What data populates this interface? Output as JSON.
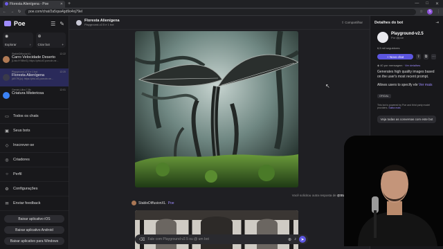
{
  "browser": {
    "tab_title": "Floresta Alienígena - Poe",
    "url": "poe.com/chat/2a5qsa4gd9o4nj79el",
    "profile_initial": "S"
  },
  "sidebar": {
    "logo": "Poe",
    "explore_label": "Explorar",
    "create_bot_label": "Criar bot",
    "conversations": [
      {
        "bot": "StableDiffusionXL",
        "time": "12:22",
        "title": "Carro Velocidade Deserto",
        "snippet": "[Link=fY98hrG]: https://pfst.cf2.poecdn.ne...",
        "color": "#b07a55"
      },
      {
        "bot": "Playground-v2.5 e 1 bot",
        "time": "12:20",
        "title": "Floresta Alienígena",
        "snippet": "[AR7RQz]: https://pfst.cf2.poecdn.ne...",
        "color": "#3a3a4a"
      },
      {
        "bot": "Gemini-Ultra 7-8b",
        "time": "12:01",
        "title": "Criatura Misteriosa",
        "snippet": "",
        "color": "#3b82f6"
      }
    ],
    "menu": [
      {
        "icon": "chat-bubbles-icon",
        "glyph": "▭",
        "label": "Todos os chats"
      },
      {
        "icon": "bots-icon",
        "glyph": "▣",
        "label": "Seus bots"
      },
      {
        "icon": "subscribe-icon",
        "glyph": "◇",
        "label": "Inscrever-se"
      },
      {
        "icon": "creators-icon",
        "glyph": "◎",
        "label": "Criadores"
      },
      {
        "icon": "profile-icon",
        "glyph": "○",
        "label": "Perfil"
      },
      {
        "icon": "settings-icon",
        "glyph": "⚙",
        "label": "Configurações"
      },
      {
        "icon": "feedback-icon",
        "glyph": "✉",
        "label": "Enviar feedback"
      }
    ],
    "downloads": [
      "Baixar aplicativo iOS",
      "Baixar aplicativo Android",
      "Baixar aplicativo para Windows"
    ]
  },
  "chat": {
    "title": "Floresta Alienígena",
    "subtitle": "Playground-v2.5 e 1 bot",
    "share_label": "Compartilhar",
    "vote_text": "Você solicitou outra resposta de",
    "vote_bot": "@StableDiffusionXL",
    "reply_bot": "StableDiffusionXL",
    "reply_tag": "Poe",
    "composer_placeholder": "Fale com Playground-v2.5 ou @ um bot"
  },
  "details": {
    "header": "Detalhes do bot",
    "bot_name": "Playground-v2.5",
    "by_prefix": "Por",
    "by_name": "@poe",
    "followers": "6,5 mil seguidores",
    "messages_points": "40",
    "messages_label": "por mensagem ·",
    "details_link": "Ver detalhes",
    "new_chat_label": "+ Novo chat",
    "description": "Generates high quality images based on the user's most recent prompt.",
    "description2": "Allows users to specify ele",
    "more_link": "Ver mais",
    "badge": "OFICIAL",
    "note": "This bot is powered by Poe and third party model providers.",
    "note_link": "Saiba mais",
    "see_all_label": "Veja todas as conversas com este bot"
  }
}
